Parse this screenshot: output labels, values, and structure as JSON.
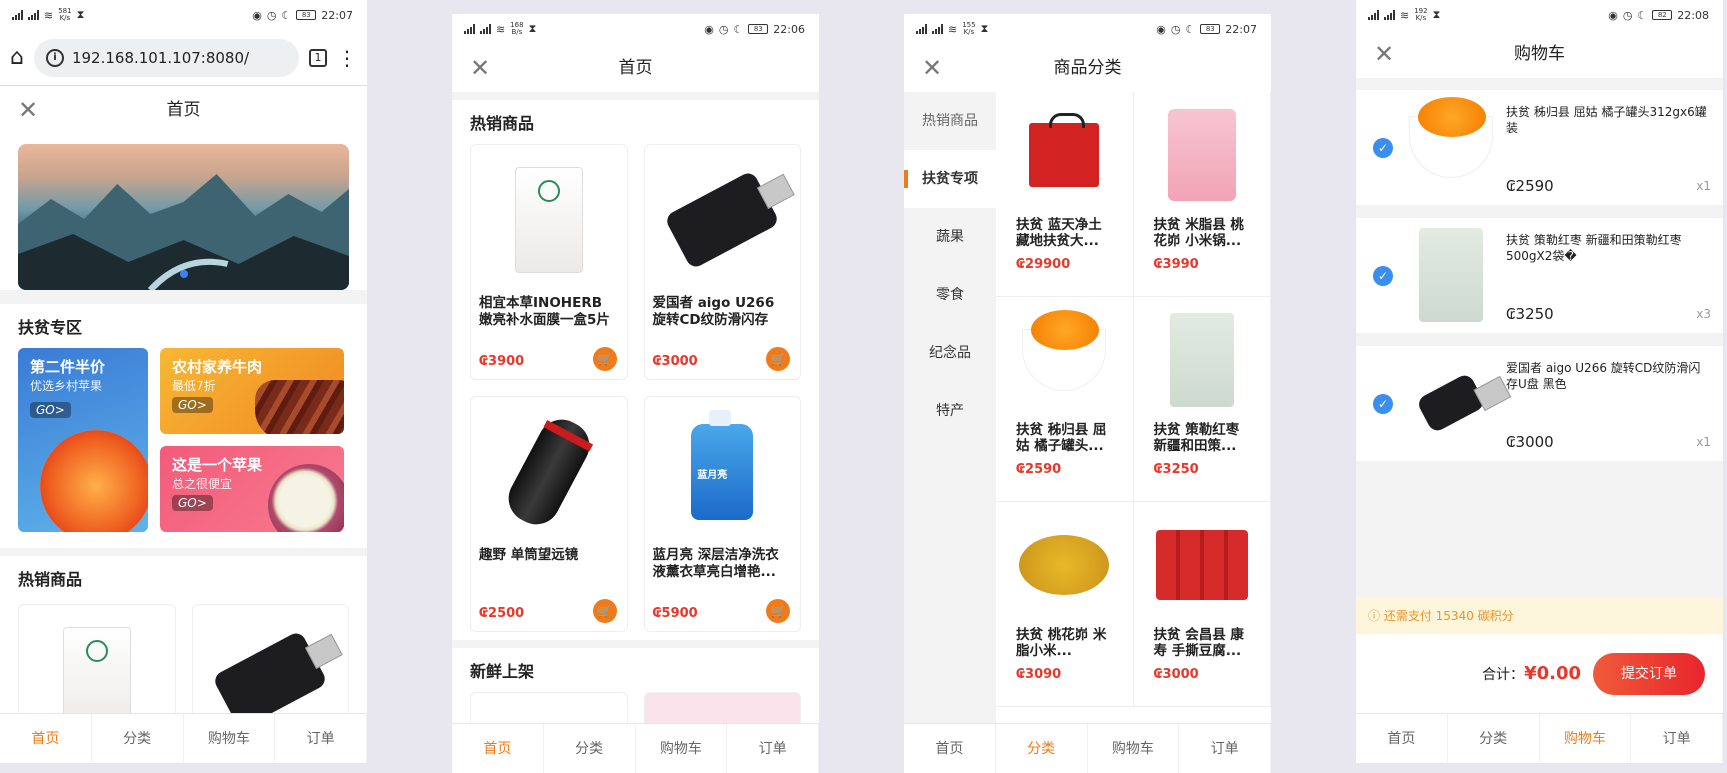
{
  "screens": {
    "home": {
      "status": {
        "net": "581",
        "unit": "K/s",
        "time": "22:07",
        "battery": "83"
      },
      "browser": {
        "url": "192.168.101.107:8080/",
        "tab_count": "1"
      },
      "title": "首页",
      "section_poverty": "扶贫专区",
      "promo": [
        {
          "title": "第二件半价",
          "sub": "优选乡村苹果",
          "go": "GO>"
        },
        {
          "title": "农村家养牛肉",
          "sub": "最低7折",
          "go": "GO>"
        },
        {
          "title": "这是一个苹果",
          "sub": "总之很便宜",
          "go": "GO>"
        }
      ],
      "section_hot": "热销商品"
    },
    "hot": {
      "status": {
        "net": "168",
        "unit": "B/s",
        "time": "22:06",
        "battery": "83"
      },
      "title": "首页",
      "section_hot": "热销商品",
      "products": [
        {
          "name": "相宜本草INOHERB 嫩亮补水面膜一盒5片装",
          "price": "₢3900"
        },
        {
          "name": "爱国者 aigo U266 旋转CD纹防滑闪存U...",
          "price": "₢3000"
        },
        {
          "name": "趣野 单筒望远镜",
          "price": "₢2500"
        },
        {
          "name": "蓝月亮 深层洁净洗衣液薰衣草亮白增艳...",
          "price": "₢5900"
        }
      ],
      "section_new": "新鲜上架"
    },
    "category": {
      "status": {
        "net": "155",
        "unit": "K/s",
        "time": "22:07",
        "battery": "83"
      },
      "title": "商品分类",
      "sidebar": [
        "热销商品",
        "扶贫专项",
        "蔬果",
        "零食",
        "纪念品",
        "特产"
      ],
      "products": [
        {
          "name": "扶贫 蓝天净土 藏地扶贫大...",
          "price": "₢29900"
        },
        {
          "name": "扶贫 米脂县 桃花峁 小米锅...",
          "price": "₢3990"
        },
        {
          "name": "扶贫 秭归县 屈姑 橘子罐头...",
          "price": "₢2590"
        },
        {
          "name": "扶贫 策勒红枣 新疆和田策...",
          "price": "₢3250"
        },
        {
          "name": "扶贫 桃花峁 米脂小米...",
          "price": "₢3090"
        },
        {
          "name": "扶贫 会昌县 康寿 手撕豆腐...",
          "price": "₢3000"
        }
      ]
    },
    "cart": {
      "status": {
        "net": "192",
        "unit": "K/s",
        "time": "22:08",
        "battery": "82"
      },
      "title": "购物车",
      "items": [
        {
          "name": "扶贫 秭归县 屈姑 橘子罐头312gx6罐装",
          "price": "₢2590",
          "qty": "x1"
        },
        {
          "name": "扶贫 策勒红枣 新疆和田策勒红枣500gX2袋�",
          "price": "₢3250",
          "qty": "x3"
        },
        {
          "name": "爱国者 aigo U266 旋转CD纹防滑闪存U盘 黑色",
          "price": "₢3000",
          "qty": "x1"
        }
      ],
      "notice": "还需支付 15340 碳积分",
      "total_label": "合计：",
      "total_value": "¥0.00",
      "submit": "提交订单"
    }
  },
  "tabbar": [
    "首页",
    "分类",
    "购物车",
    "订单"
  ],
  "colors": {
    "accent": "#f07b1a",
    "price": "#e8382c",
    "check": "#3a8ef0"
  }
}
